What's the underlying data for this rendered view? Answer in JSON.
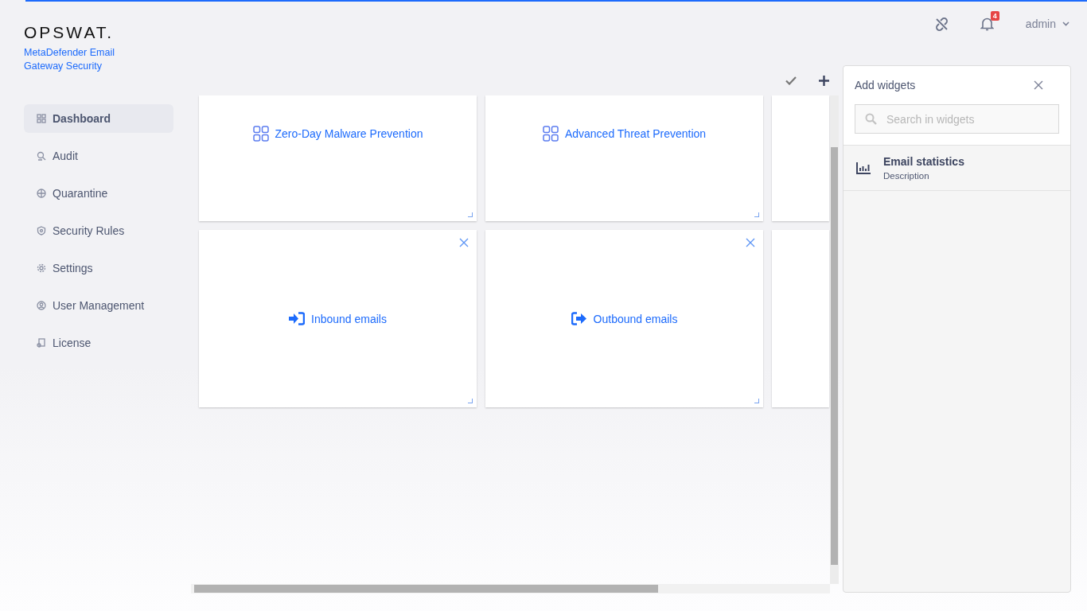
{
  "brand": {
    "logo": "OPSWAT.",
    "product": "MetaDefender Email Gateway Security"
  },
  "nav": [
    {
      "label": "Dashboard",
      "kind": "grid",
      "selected": true
    },
    {
      "label": "Audit",
      "kind": "audit",
      "selected": false
    },
    {
      "label": "Quarantine",
      "kind": "globe",
      "selected": false
    },
    {
      "label": "Security Rules",
      "kind": "shield",
      "selected": false
    },
    {
      "label": "Settings",
      "kind": "gear",
      "selected": false
    },
    {
      "label": "User Management",
      "kind": "user",
      "selected": false
    },
    {
      "label": "License",
      "kind": "license",
      "selected": false
    }
  ],
  "header": {
    "notifications": "4",
    "user": "admin"
  },
  "widget_rows": [
    [
      {
        "kind": "grid",
        "title": "Zero-Day Malware Prevention",
        "removable": false
      },
      {
        "kind": "grid",
        "title": "Advanced Threat Prevention",
        "removable": false
      },
      {
        "kind": "blank"
      }
    ],
    [
      {
        "kind": "inbound",
        "title": "Inbound emails",
        "removable": true
      },
      {
        "kind": "outbound",
        "title": "Outbound emails",
        "removable": true
      },
      {
        "kind": "blank"
      }
    ]
  ],
  "add_widgets": {
    "title": "Add widgets",
    "search": {
      "placeholder": "Search in widgets"
    },
    "items": [
      {
        "title": "Email statistics",
        "description": "Description"
      }
    ]
  }
}
